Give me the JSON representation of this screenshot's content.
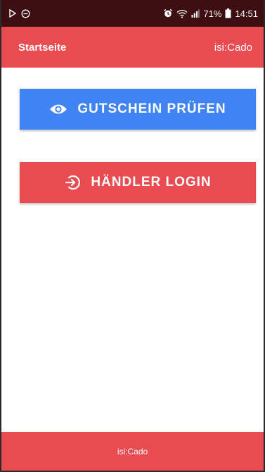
{
  "status_bar": {
    "battery_percent": "71%",
    "time": "14:51",
    "icons": [
      "play-icon",
      "do-not-disturb-icon",
      "alarm-icon",
      "wifi-icon",
      "signal-icon",
      "battery-icon"
    ]
  },
  "app_bar": {
    "title": "Startseite",
    "brand": "isi:Cado"
  },
  "actions": {
    "check_voucher_label": "GUTSCHEIN PRÜFEN",
    "check_voucher_icon": "eye-icon",
    "merchant_login_label": "HÄNDLER LOGIN",
    "merchant_login_icon": "login-icon"
  },
  "footer": {
    "text": "isi:Cado"
  },
  "colors": {
    "primary_red": "#e84c51",
    "primary_blue": "#4083f3",
    "status_bar": "#3d0f13"
  }
}
